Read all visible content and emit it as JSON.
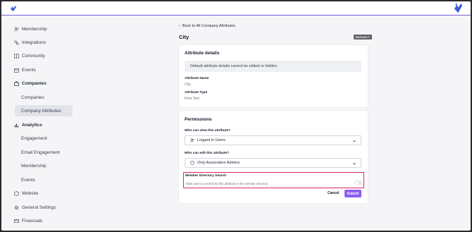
{
  "sidebar": {
    "items": [
      {
        "label": "Membership",
        "icon": "users-icon"
      },
      {
        "label": "Integrations",
        "icon": "link-icon"
      },
      {
        "label": "Community",
        "icon": "book-icon"
      },
      {
        "label": "Events",
        "icon": "calendar-icon"
      },
      {
        "label": "Companies",
        "icon": "briefcase-icon"
      },
      {
        "label": "Companies"
      },
      {
        "label": "Company Attributes"
      },
      {
        "label": "Analytics",
        "icon": "bar-chart-icon"
      },
      {
        "label": "Engagement"
      },
      {
        "label": "Email Engagement"
      },
      {
        "label": "Membership"
      },
      {
        "label": "Events"
      },
      {
        "label": "Website",
        "icon": "cube-icon"
      },
      {
        "label": "General Settings",
        "icon": "gear-icon"
      },
      {
        "label": "Financials",
        "icon": "card-icon"
      }
    ]
  },
  "header": {
    "back_label": "Back to All Company Attributes",
    "title": "City",
    "badge": "DEFAULT"
  },
  "details": {
    "title": "Attribute details",
    "notice": "Default attribute details cannot be edited or hidden.",
    "name_label": "Attribute Name",
    "name_value": "City",
    "type_label": "Attribute Type",
    "type_value": "Free Text"
  },
  "permissions": {
    "title": "Permissions",
    "view_label": "Who can view this attribute?",
    "view_value": "Logged in Users",
    "edit_label": "Who can edit this attribute?",
    "edit_value": "Only Association Admins",
    "search_title": "Member Directory Search",
    "search_desc": "Allow users to search by this attribute in the member directory",
    "cancel_label": "Cancel",
    "submit_label": "Submit"
  },
  "colors": {
    "accent": "#8b5cf6",
    "highlight": "#d6245e",
    "active_bg": "#e3e4ea"
  }
}
